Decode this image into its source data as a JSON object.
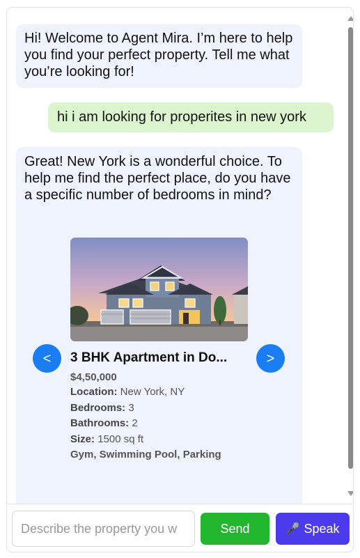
{
  "messages": [
    {
      "role": "bot",
      "text": "Hi! Welcome to Agent Mira. I’m here to help you find your perfect property. Tell me what you’re looking for!"
    },
    {
      "role": "user",
      "text": "hi i am looking for properites in new york"
    },
    {
      "role": "bot",
      "text": "Great! New York is a wonderful choice. To help me find the perfect place, do you have a specific number of bedrooms in mind?"
    }
  ],
  "carousel": {
    "prev_label": "<",
    "next_label": ">",
    "property": {
      "title": "3 BHK Apartment in Do...",
      "price": "$4,50,000",
      "location_label": "Location:",
      "location": "New York, NY",
      "bedrooms_label": "Bedrooms:",
      "bedrooms": "3",
      "bathrooms_label": "Bathrooms:",
      "bathrooms": "2",
      "size_label": "Size:",
      "size": "1500 sq ft",
      "amenities": "Gym, Swimming Pool, Parking"
    }
  },
  "composer": {
    "placeholder": "Describe the property you w",
    "send_label": "Send",
    "speak_label": "Speak",
    "speak_icon": "microphone-icon"
  },
  "colors": {
    "bot_bubble": "#eef3fd",
    "user_bubble": "#dcf5cf",
    "nav_button": "#1a7ef2",
    "send_button": "#22b52e",
    "speak_button": "#4c3bea"
  }
}
